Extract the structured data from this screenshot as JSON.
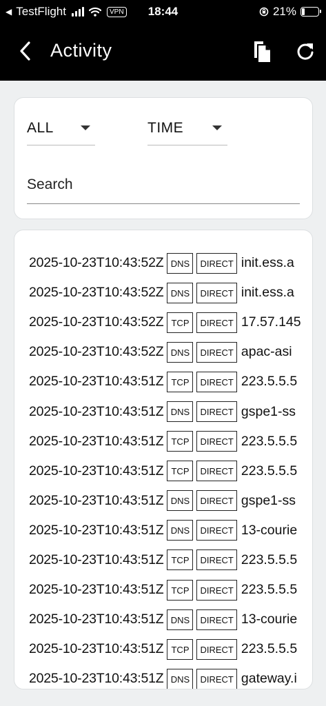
{
  "status_bar": {
    "back_app": "TestFlight",
    "vpn": "VPN",
    "time": "18:44",
    "battery": "21%",
    "battery_level": 0.21
  },
  "header": {
    "title": "Activity",
    "icons": {
      "back": "chevron-left-icon",
      "copy": "copy-icon",
      "refresh": "refresh-icon"
    }
  },
  "filters": {
    "type_value": "ALL",
    "sort_value": "TIME",
    "search_placeholder": "Search"
  },
  "logs": [
    {
      "time": "2025-10-23T10:43:52Z",
      "proto": "DNS",
      "rule": "DIRECT",
      "host": "init.ess.a"
    },
    {
      "time": "2025-10-23T10:43:52Z",
      "proto": "DNS",
      "rule": "DIRECT",
      "host": "init.ess.a"
    },
    {
      "time": "2025-10-23T10:43:52Z",
      "proto": "TCP",
      "rule": "DIRECT",
      "host": "17.57.145"
    },
    {
      "time": "2025-10-23T10:43:52Z",
      "proto": "DNS",
      "rule": "DIRECT",
      "host": "apac-asi"
    },
    {
      "time": "2025-10-23T10:43:51Z",
      "proto": "TCP",
      "rule": "DIRECT",
      "host": "223.5.5.5"
    },
    {
      "time": "2025-10-23T10:43:51Z",
      "proto": "DNS",
      "rule": "DIRECT",
      "host": "gspe1-ss"
    },
    {
      "time": "2025-10-23T10:43:51Z",
      "proto": "TCP",
      "rule": "DIRECT",
      "host": "223.5.5.5"
    },
    {
      "time": "2025-10-23T10:43:51Z",
      "proto": "TCP",
      "rule": "DIRECT",
      "host": "223.5.5.5"
    },
    {
      "time": "2025-10-23T10:43:51Z",
      "proto": "DNS",
      "rule": "DIRECT",
      "host": "gspe1-ss"
    },
    {
      "time": "2025-10-23T10:43:51Z",
      "proto": "DNS",
      "rule": "DIRECT",
      "host": "13-courie"
    },
    {
      "time": "2025-10-23T10:43:51Z",
      "proto": "TCP",
      "rule": "DIRECT",
      "host": "223.5.5.5"
    },
    {
      "time": "2025-10-23T10:43:51Z",
      "proto": "TCP",
      "rule": "DIRECT",
      "host": "223.5.5.5"
    },
    {
      "time": "2025-10-23T10:43:51Z",
      "proto": "DNS",
      "rule": "DIRECT",
      "host": "13-courie"
    },
    {
      "time": "2025-10-23T10:43:51Z",
      "proto": "TCP",
      "rule": "DIRECT",
      "host": "223.5.5.5"
    },
    {
      "time": "2025-10-23T10:43:51Z",
      "proto": "DNS",
      "rule": "DIRECT",
      "host": "gateway.i"
    }
  ]
}
